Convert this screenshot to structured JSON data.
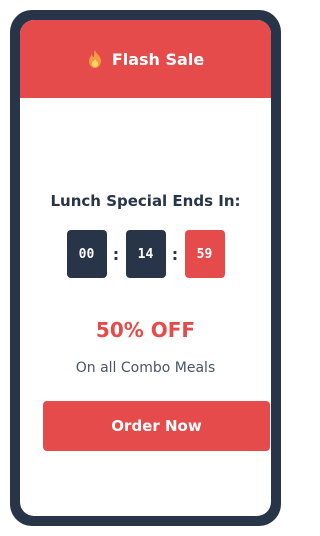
{
  "header": {
    "icon": "fire-icon",
    "title": "Flash Sale"
  },
  "countdown": {
    "label": "Lunch Special Ends In:",
    "hours": "00",
    "minutes": "14",
    "seconds": "59",
    "separator": ":"
  },
  "offer": {
    "discount": "50% OFF",
    "subtitle": "On all Combo Meals"
  },
  "cta": {
    "label": "Order Now"
  },
  "colors": {
    "accent": "#e54b4b",
    "dark": "#283447"
  }
}
